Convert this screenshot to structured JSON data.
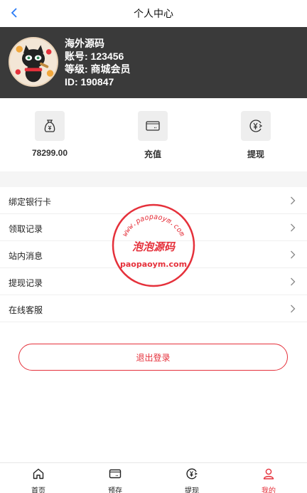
{
  "header": {
    "title": "个人中心"
  },
  "profile": {
    "name": "海外源码",
    "account": "账号: 123456",
    "level": "等级: 商城会员",
    "id": "ID: 190847"
  },
  "quick_actions": [
    {
      "label": "78299.00",
      "icon": "money-bag-icon"
    },
    {
      "label": "充值",
      "icon": "card-icon"
    },
    {
      "label": "提现",
      "icon": "yuan-exchange-icon"
    }
  ],
  "menu": [
    {
      "label": "绑定银行卡"
    },
    {
      "label": "领取记录"
    },
    {
      "label": "站内消息"
    },
    {
      "label": "提现记录"
    },
    {
      "label": "在线客服"
    }
  ],
  "logout": {
    "label": "退出登录"
  },
  "watermark": {
    "top_text": "www.paopaoym.com",
    "center_text": "泡泡源码",
    "bottom_text": "paopaoym.com"
  },
  "tabs": [
    {
      "label": "首页",
      "icon": "home-icon"
    },
    {
      "label": "预存",
      "icon": "card-icon"
    },
    {
      "label": "提现",
      "icon": "yuan-exchange-icon"
    },
    {
      "label": "我的",
      "icon": "user-icon",
      "active": true
    }
  ],
  "colors": {
    "accent": "#e5313b",
    "back_arrow": "#2a7cf6",
    "profile_bg": "#3a3a3a"
  }
}
